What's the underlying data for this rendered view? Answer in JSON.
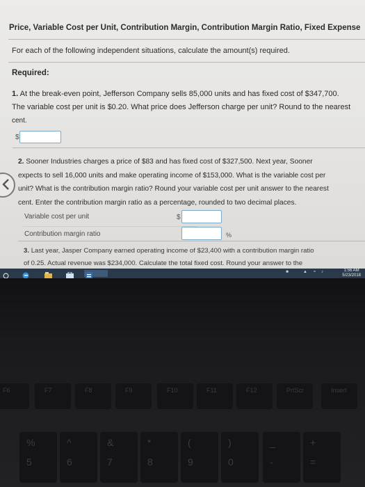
{
  "problem": {
    "title": "Price, Variable Cost per Unit, Contribution Margin, Contribution Margin Ratio, Fixed Expense",
    "instruction": "For each of the following independent situations, calculate the amount(s) required.",
    "required_label": "Required:",
    "q1": {
      "number": "1.",
      "line1": "At the break-even point, Jefferson Company sells 85,000 units and has fixed cost of $347,700.",
      "line2": "The variable cost per unit is $0.20. What price does Jefferson charge per unit? Round to the nearest",
      "line3": "cent.",
      "prefix": "$",
      "answer": ""
    },
    "q2": {
      "number": "2.",
      "line1": "Sooner Industries charges a price of $83 and has fixed cost of $327,500. Next year, Sooner",
      "line2": "expects to sell 16,000 units and make operating income of $153,000. What is the variable cost per",
      "line3": "unit? What is the contribution margin ratio? Round your variable cost per unit answer to the nearest",
      "line4": "cent. Enter the contribution margin ratio as a percentage, rounded to two decimal places.",
      "vc_label": "Variable cost per unit",
      "vc_prefix": "$",
      "vc_answer": "",
      "cmr_label": "Contribution margin ratio",
      "cmr_suffix": "%",
      "cmr_answer": ""
    },
    "q3": {
      "number": "3.",
      "line1": "Last year, Jasper Company earned operating income of $23,400 with a contribution margin ratio",
      "line2": "of 0.25. Actual revenue was $234,000. Calculate the total fixed cost. Round your answer to the"
    }
  },
  "taskbar": {
    "time": "1:56 AM",
    "date": "5/23/2018"
  },
  "keyboard": {
    "function_keys": [
      "F6",
      "F7",
      "F8",
      "F9",
      "F10",
      "F11",
      "F12",
      "PrtScr",
      "Insert"
    ],
    "number_keys": [
      "5",
      "6",
      "7",
      "8",
      "9",
      "0",
      "-",
      "="
    ],
    "shift_symbols": [
      "%",
      "^",
      "&",
      "*",
      "(",
      ")",
      "_",
      "+"
    ]
  }
}
